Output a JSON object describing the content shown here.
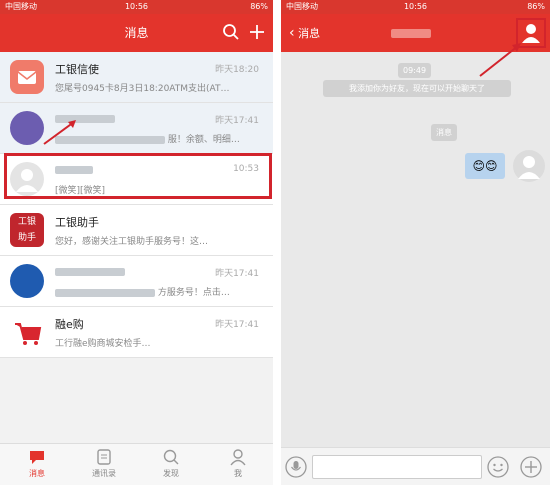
{
  "left": {
    "status": {
      "carrier": "中国移动",
      "time": "10:56",
      "battery": "86%"
    },
    "header": {
      "title": "消息"
    },
    "items": [
      {
        "name": "工银信使",
        "time": "昨天18:20",
        "preview": "您尾号0945卡8月3日18:20ATM支出(AT…"
      },
      {
        "name": "",
        "time": "昨天17:41",
        "preview": "服！余额、明细…"
      },
      {
        "name": "",
        "time": "10:53",
        "preview": "[微笑][微笑]"
      },
      {
        "name": "工银助手",
        "time": "",
        "preview": "您好，感谢关注工银助手服务号！这…"
      },
      {
        "name": "",
        "time": "昨天17:41",
        "preview": "方服务号！点击…"
      },
      {
        "name": "融e购",
        "time": "昨天17:41",
        "preview": "工行融e购商城安检手…"
      }
    ],
    "tabs": [
      {
        "label": "消息"
      },
      {
        "label": "通讯录"
      },
      {
        "label": "发现"
      },
      {
        "label": "我"
      }
    ]
  },
  "right": {
    "status": {
      "carrier": "中国移动",
      "time": "10:56",
      "battery": "86%"
    },
    "header": {
      "back_label": "消息"
    },
    "time_stamp": "09:49",
    "system_msg": "我添加你为好友，现在可以开始聊天了",
    "system_msg2": "消息",
    "emoji_msg": "😊😊"
  },
  "colors": {
    "brand": "#e3342c",
    "highlight": "#d2242c"
  }
}
